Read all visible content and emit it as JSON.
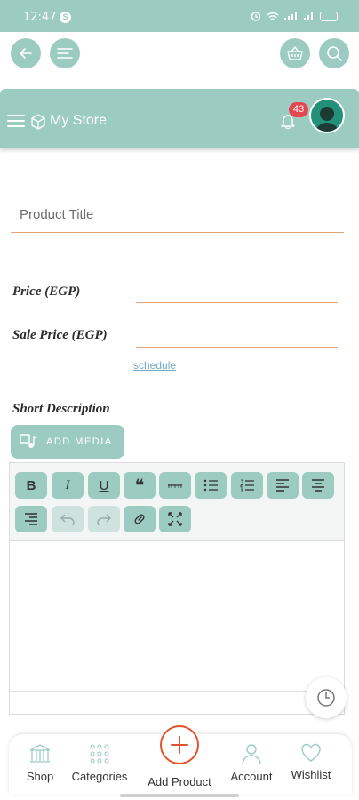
{
  "status_bar": {
    "time": "12:47",
    "badge": "S",
    "battery": "100"
  },
  "top_bar": {
    "back_icon": "arrow-left-icon",
    "menu_icon": "menu-icon",
    "cart_icon": "basket-icon",
    "search_icon": "search-icon"
  },
  "store_bar": {
    "title": "My Store",
    "notification_count": "43"
  },
  "form": {
    "product_title_placeholder": "Product Title",
    "price_label": "Price (EGP)",
    "sale_price_label": "Sale Price (EGP)",
    "schedule_link": "schedule",
    "short_description_label": "Short Description",
    "add_media_label": "ADD MEDIA"
  },
  "editor": {
    "toolbar": [
      "bold",
      "italic",
      "underline",
      "blockquote",
      "strikethrough",
      "bullet-list",
      "numbered-list",
      "align-left",
      "align-center",
      "align-right",
      "undo",
      "redo",
      "link",
      "fullscreen"
    ],
    "bold_glyph": "B",
    "italic_glyph": "I",
    "underline_glyph": "U",
    "quote_glyph": "❝"
  },
  "bottom_nav": {
    "items": [
      {
        "label": "Shop"
      },
      {
        "label": "Categories"
      },
      {
        "label": "Add Product"
      },
      {
        "label": "Account"
      },
      {
        "label": "Wishlist"
      }
    ]
  },
  "colors": {
    "accent": "#9ccbc2",
    "underline": "#e8a27a",
    "badge": "#e4474f",
    "add_product": "#e2532d"
  }
}
